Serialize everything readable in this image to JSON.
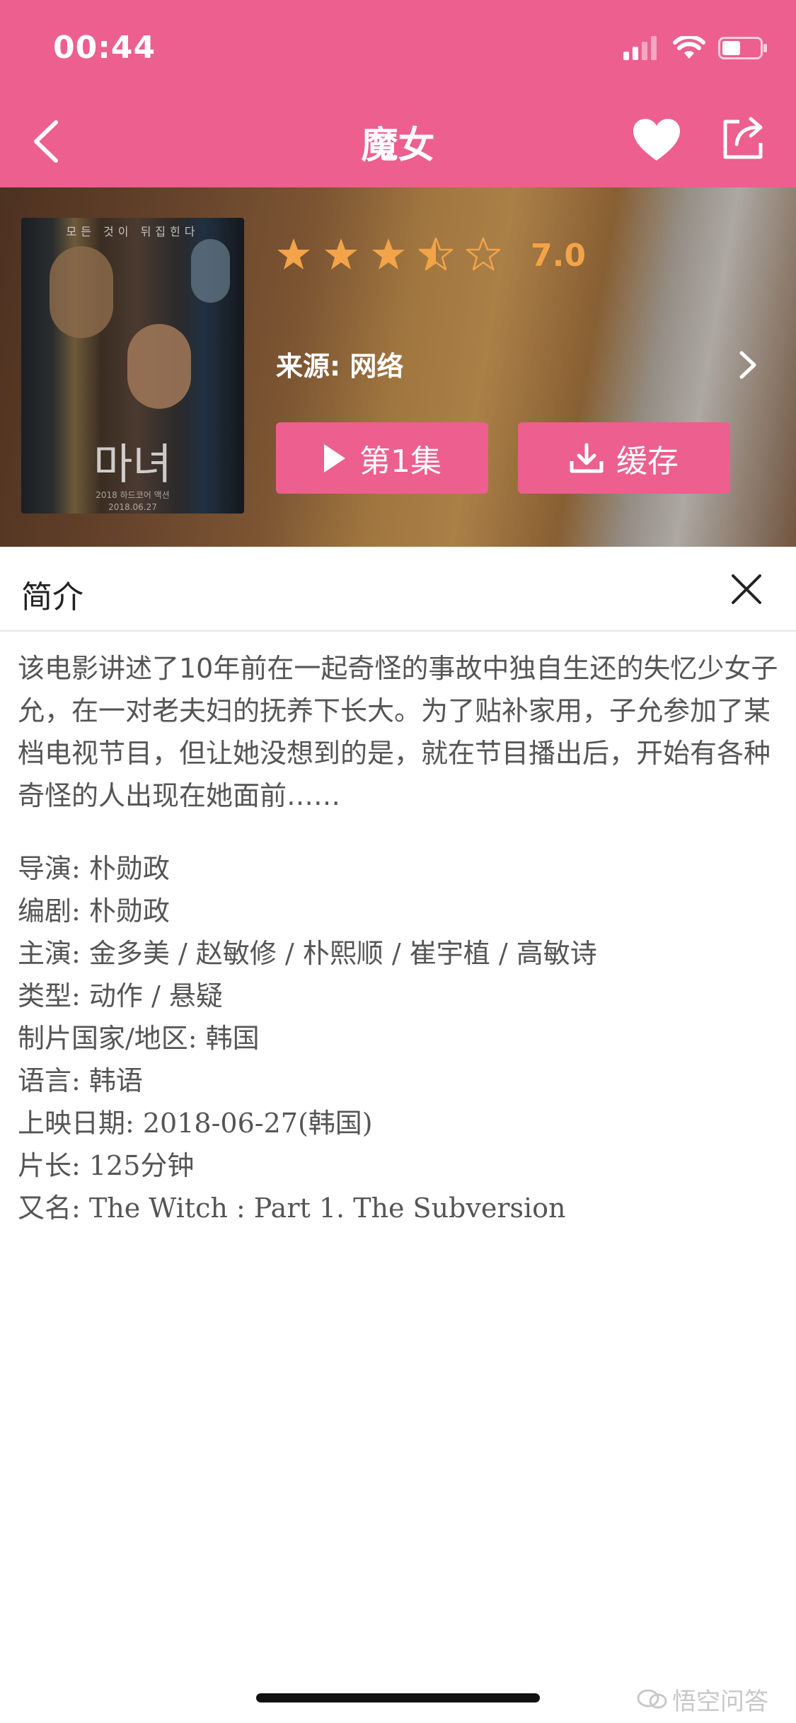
{
  "status_bar": {
    "time": "00:44"
  },
  "nav": {
    "title": "魔女"
  },
  "hero": {
    "poster": {
      "title": "마녀",
      "tagline": "모든 것이 뒤집힌다",
      "credit": "2018 하드코어 액션",
      "date": "2018.06.27"
    },
    "rating": {
      "value": "7.0",
      "stars": 3.5,
      "max_stars": 5,
      "color": "#f3a348"
    },
    "source_label": "来源: 网络",
    "play_button": "第1集",
    "cache_button": "缓存"
  },
  "intro": {
    "title": "简介",
    "synopsis": "该电影讲述了10年前在一起奇怪的事故中独自生还的失忆少女子允，在一对老夫妇的抚养下长大。为了贴补家用，子允参加了某档电视节目，但让她没想到的是，就在节目播出后，开始有各种奇怪的人出现在她面前……",
    "details": [
      "导演: 朴勋政",
      "编剧: 朴勋政",
      "主演: 金多美 / 赵敏修 / 朴熙顺 / 崔宇植 / 高敏诗",
      "类型: 动作 / 悬疑",
      "制片国家/地区: 韩国",
      "语言: 韩语",
      "上映日期: 2018-06-27(韩国)",
      "片长: 125分钟",
      "又名: The Witch : Part 1. The Subversion"
    ]
  },
  "watermark": "悟空问答",
  "colors": {
    "accent": "#ec5f8f",
    "star": "#f3a348",
    "text": "#555555"
  }
}
